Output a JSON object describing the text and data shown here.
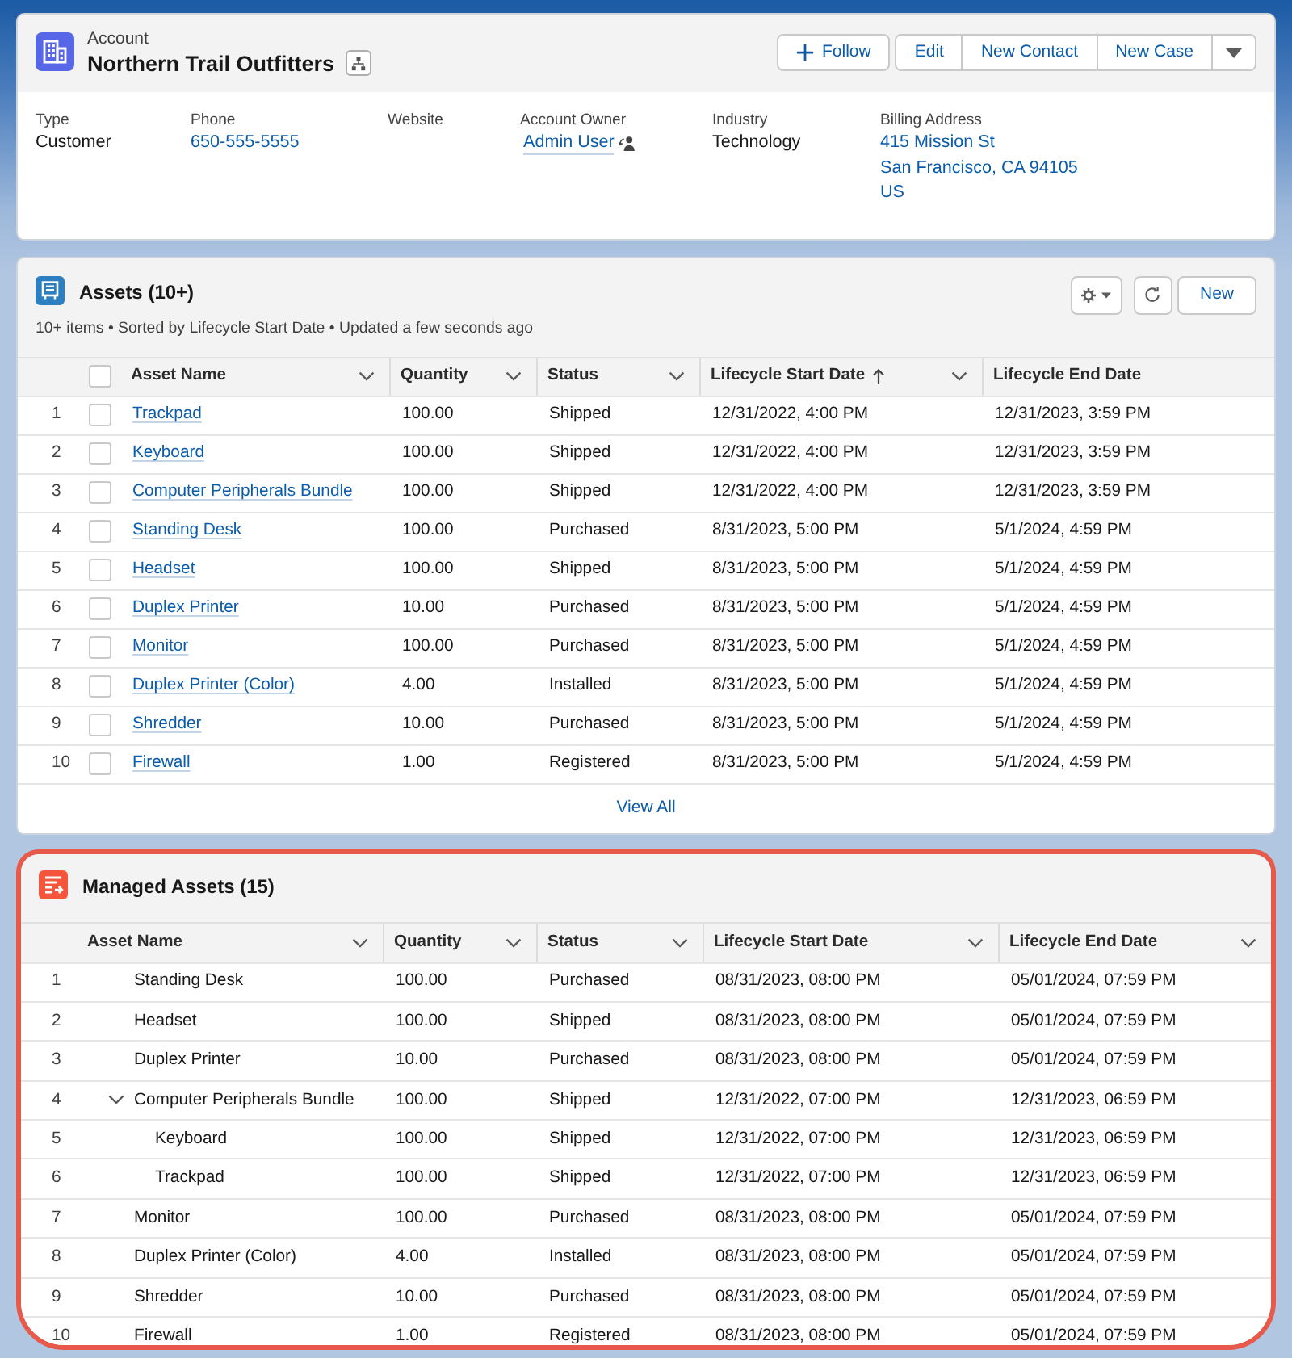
{
  "record": {
    "object_type": "Account",
    "title": "Northern Trail Outfitters",
    "actions": [
      {
        "label": "Follow",
        "kind": "follow"
      },
      {
        "label": "Edit",
        "kind": "grouped"
      },
      {
        "label": "New Contact",
        "kind": "grouped"
      },
      {
        "label": "New Case",
        "kind": "grouped"
      }
    ],
    "fields": [
      {
        "label": "Type",
        "kind": "text",
        "value": "Customer"
      },
      {
        "label": "Phone",
        "kind": "link",
        "value": "650-555-5555"
      },
      {
        "label": "Website"
      },
      {
        "label": "Account Owner",
        "kind": "user",
        "value": "Admin User"
      },
      {
        "label": "Industry",
        "kind": "text",
        "value": "Technology"
      },
      {
        "label": "Billing Address",
        "kind": "link",
        "lines": [
          "415 Mission St",
          "San Francisco, CA 94105",
          "US"
        ]
      }
    ]
  },
  "assets": {
    "title": "Assets (10+)",
    "summary": "10+ items • Sorted by Lifecycle Start Date • Updated a few seconds ago",
    "new_button": "New",
    "select_all_checked": false,
    "columns": [
      {
        "label": "Asset Name",
        "sorted": false,
        "menu": true
      },
      {
        "label": "Quantity",
        "sorted": false,
        "menu": true
      },
      {
        "label": "Status",
        "sorted": false,
        "menu": true
      },
      {
        "label": "Lifecycle Start Date",
        "sorted": true,
        "menu": true
      },
      {
        "label": "Lifecycle End Date",
        "sorted": false,
        "menu": false
      }
    ],
    "rows": [
      {
        "number": "1",
        "checked": false,
        "name": "Trackpad",
        "quantity": "100.00",
        "status": "Shipped",
        "start_date": "12/31/2022, 4:00 PM",
        "end_date": "12/31/2023, 3:59 PM"
      },
      {
        "number": "2",
        "checked": false,
        "name": "Keyboard",
        "quantity": "100.00",
        "status": "Shipped",
        "start_date": "12/31/2022, 4:00 PM",
        "end_date": "12/31/2023, 3:59 PM"
      },
      {
        "number": "3",
        "checked": false,
        "name": "Computer Peripherals Bundle",
        "quantity": "100.00",
        "status": "Shipped",
        "start_date": "12/31/2022, 4:00 PM",
        "end_date": "12/31/2023, 3:59 PM"
      },
      {
        "number": "4",
        "checked": false,
        "name": "Standing Desk",
        "quantity": "100.00",
        "status": "Purchased",
        "start_date": "8/31/2023, 5:00 PM",
        "end_date": "5/1/2024, 4:59 PM"
      },
      {
        "number": "5",
        "checked": false,
        "name": "Headset",
        "quantity": "100.00",
        "status": "Shipped",
        "start_date": "8/31/2023, 5:00 PM",
        "end_date": "5/1/2024, 4:59 PM"
      },
      {
        "number": "6",
        "checked": false,
        "name": "Duplex Printer",
        "quantity": "10.00",
        "status": "Purchased",
        "start_date": "8/31/2023, 5:00 PM",
        "end_date": "5/1/2024, 4:59 PM"
      },
      {
        "number": "7",
        "checked": false,
        "name": "Monitor",
        "quantity": "100.00",
        "status": "Purchased",
        "start_date": "8/31/2023, 5:00 PM",
        "end_date": "5/1/2024, 4:59 PM"
      },
      {
        "number": "8",
        "checked": false,
        "name": "Duplex Printer (Color)",
        "quantity": "4.00",
        "status": "Installed",
        "start_date": "8/31/2023, 5:00 PM",
        "end_date": "5/1/2024, 4:59 PM"
      },
      {
        "number": "9",
        "checked": false,
        "name": "Shredder",
        "quantity": "10.00",
        "status": "Purchased",
        "start_date": "8/31/2023, 5:00 PM",
        "end_date": "5/1/2024, 4:59 PM"
      },
      {
        "number": "10",
        "checked": false,
        "name": "Firewall",
        "quantity": "1.00",
        "status": "Registered",
        "start_date": "8/31/2023, 5:00 PM",
        "end_date": "5/1/2024, 4:59 PM"
      }
    ],
    "view_all": "View All"
  },
  "managed_assets": {
    "title": "Managed Assets (15)",
    "highlighted": true,
    "columns": [
      {
        "label": "Asset Name",
        "sorted": false,
        "menu": true
      },
      {
        "label": "Quantity",
        "sorted": false,
        "menu": true
      },
      {
        "label": "Status",
        "sorted": false,
        "menu": true
      },
      {
        "label": "Lifecycle Start Date",
        "sorted": false,
        "menu": true
      },
      {
        "label": "Lifecycle End Date",
        "sorted": false,
        "menu": true
      }
    ],
    "rows": [
      {
        "number": "1",
        "name": "Standing Desk",
        "quantity": "100.00",
        "status": "Purchased",
        "start_date": "08/31/2023, 08:00 PM",
        "end_date": "05/01/2024, 07:59 PM"
      },
      {
        "number": "2",
        "name": "Headset",
        "quantity": "100.00",
        "status": "Shipped",
        "start_date": "08/31/2023, 08:00 PM",
        "end_date": "05/01/2024, 07:59 PM"
      },
      {
        "number": "3",
        "name": "Duplex Printer",
        "quantity": "10.00",
        "status": "Purchased",
        "start_date": "08/31/2023, 08:00 PM",
        "end_date": "05/01/2024, 07:59 PM"
      },
      {
        "number": "4",
        "name": "Computer Peripherals Bundle",
        "quantity": "100.00",
        "status": "Shipped",
        "start_date": "12/31/2022, 07:00 PM",
        "end_date": "12/31/2023, 06:59 PM",
        "expanded": true,
        "children": [
          {
            "number": "5",
            "name": "Keyboard",
            "quantity": "100.00",
            "status": "Shipped",
            "start_date": "12/31/2022, 07:00 PM",
            "end_date": "12/31/2023, 06:59 PM"
          },
          {
            "number": "6",
            "name": "Trackpad",
            "quantity": "100.00",
            "status": "Shipped",
            "start_date": "12/31/2022, 07:00 PM",
            "end_date": "12/31/2023, 06:59 PM"
          }
        ]
      },
      {
        "number": "7",
        "name": "Monitor",
        "quantity": "100.00",
        "status": "Purchased",
        "start_date": "08/31/2023, 08:00 PM",
        "end_date": "05/01/2024, 07:59 PM"
      },
      {
        "number": "8",
        "name": "Duplex Printer (Color)",
        "quantity": "4.00",
        "status": "Installed",
        "start_date": "08/31/2023, 08:00 PM",
        "end_date": "05/01/2024, 07:59 PM"
      },
      {
        "number": "9",
        "name": "Shredder",
        "quantity": "10.00",
        "status": "Purchased",
        "start_date": "08/31/2023, 08:00 PM",
        "end_date": "05/01/2024, 07:59 PM"
      },
      {
        "number": "10",
        "name": "Firewall",
        "quantity": "1.00",
        "status": "Registered",
        "start_date": "08/31/2023, 08:00 PM",
        "end_date": "05/01/2024, 07:59 PM"
      }
    ]
  }
}
